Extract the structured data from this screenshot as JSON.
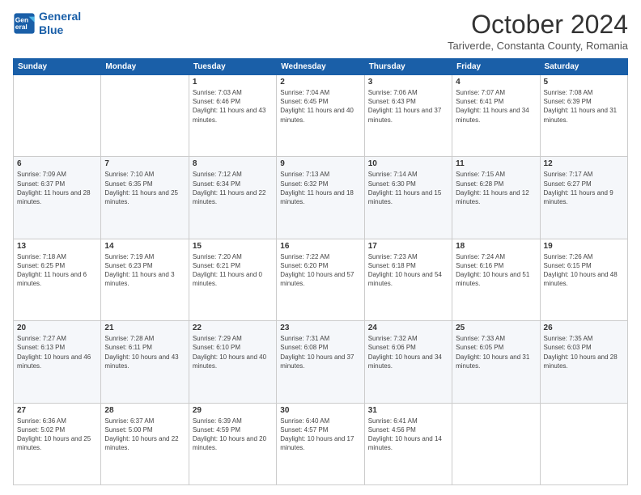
{
  "logo": {
    "line1": "General",
    "line2": "Blue"
  },
  "title": "October 2024",
  "location": "Tariverde, Constanta County, Romania",
  "days_header": [
    "Sunday",
    "Monday",
    "Tuesday",
    "Wednesday",
    "Thursday",
    "Friday",
    "Saturday"
  ],
  "weeks": [
    [
      {
        "day": "",
        "info": ""
      },
      {
        "day": "",
        "info": ""
      },
      {
        "day": "1",
        "info": "Sunrise: 7:03 AM\nSunset: 6:46 PM\nDaylight: 11 hours and 43 minutes."
      },
      {
        "day": "2",
        "info": "Sunrise: 7:04 AM\nSunset: 6:45 PM\nDaylight: 11 hours and 40 minutes."
      },
      {
        "day": "3",
        "info": "Sunrise: 7:06 AM\nSunset: 6:43 PM\nDaylight: 11 hours and 37 minutes."
      },
      {
        "day": "4",
        "info": "Sunrise: 7:07 AM\nSunset: 6:41 PM\nDaylight: 11 hours and 34 minutes."
      },
      {
        "day": "5",
        "info": "Sunrise: 7:08 AM\nSunset: 6:39 PM\nDaylight: 11 hours and 31 minutes."
      }
    ],
    [
      {
        "day": "6",
        "info": "Sunrise: 7:09 AM\nSunset: 6:37 PM\nDaylight: 11 hours and 28 minutes."
      },
      {
        "day": "7",
        "info": "Sunrise: 7:10 AM\nSunset: 6:35 PM\nDaylight: 11 hours and 25 minutes."
      },
      {
        "day": "8",
        "info": "Sunrise: 7:12 AM\nSunset: 6:34 PM\nDaylight: 11 hours and 22 minutes."
      },
      {
        "day": "9",
        "info": "Sunrise: 7:13 AM\nSunset: 6:32 PM\nDaylight: 11 hours and 18 minutes."
      },
      {
        "day": "10",
        "info": "Sunrise: 7:14 AM\nSunset: 6:30 PM\nDaylight: 11 hours and 15 minutes."
      },
      {
        "day": "11",
        "info": "Sunrise: 7:15 AM\nSunset: 6:28 PM\nDaylight: 11 hours and 12 minutes."
      },
      {
        "day": "12",
        "info": "Sunrise: 7:17 AM\nSunset: 6:27 PM\nDaylight: 11 hours and 9 minutes."
      }
    ],
    [
      {
        "day": "13",
        "info": "Sunrise: 7:18 AM\nSunset: 6:25 PM\nDaylight: 11 hours and 6 minutes."
      },
      {
        "day": "14",
        "info": "Sunrise: 7:19 AM\nSunset: 6:23 PM\nDaylight: 11 hours and 3 minutes."
      },
      {
        "day": "15",
        "info": "Sunrise: 7:20 AM\nSunset: 6:21 PM\nDaylight: 11 hours and 0 minutes."
      },
      {
        "day": "16",
        "info": "Sunrise: 7:22 AM\nSunset: 6:20 PM\nDaylight: 10 hours and 57 minutes."
      },
      {
        "day": "17",
        "info": "Sunrise: 7:23 AM\nSunset: 6:18 PM\nDaylight: 10 hours and 54 minutes."
      },
      {
        "day": "18",
        "info": "Sunrise: 7:24 AM\nSunset: 6:16 PM\nDaylight: 10 hours and 51 minutes."
      },
      {
        "day": "19",
        "info": "Sunrise: 7:26 AM\nSunset: 6:15 PM\nDaylight: 10 hours and 48 minutes."
      }
    ],
    [
      {
        "day": "20",
        "info": "Sunrise: 7:27 AM\nSunset: 6:13 PM\nDaylight: 10 hours and 46 minutes."
      },
      {
        "day": "21",
        "info": "Sunrise: 7:28 AM\nSunset: 6:11 PM\nDaylight: 10 hours and 43 minutes."
      },
      {
        "day": "22",
        "info": "Sunrise: 7:29 AM\nSunset: 6:10 PM\nDaylight: 10 hours and 40 minutes."
      },
      {
        "day": "23",
        "info": "Sunrise: 7:31 AM\nSunset: 6:08 PM\nDaylight: 10 hours and 37 minutes."
      },
      {
        "day": "24",
        "info": "Sunrise: 7:32 AM\nSunset: 6:06 PM\nDaylight: 10 hours and 34 minutes."
      },
      {
        "day": "25",
        "info": "Sunrise: 7:33 AM\nSunset: 6:05 PM\nDaylight: 10 hours and 31 minutes."
      },
      {
        "day": "26",
        "info": "Sunrise: 7:35 AM\nSunset: 6:03 PM\nDaylight: 10 hours and 28 minutes."
      }
    ],
    [
      {
        "day": "27",
        "info": "Sunrise: 6:36 AM\nSunset: 5:02 PM\nDaylight: 10 hours and 25 minutes."
      },
      {
        "day": "28",
        "info": "Sunrise: 6:37 AM\nSunset: 5:00 PM\nDaylight: 10 hours and 22 minutes."
      },
      {
        "day": "29",
        "info": "Sunrise: 6:39 AM\nSunset: 4:59 PM\nDaylight: 10 hours and 20 minutes."
      },
      {
        "day": "30",
        "info": "Sunrise: 6:40 AM\nSunset: 4:57 PM\nDaylight: 10 hours and 17 minutes."
      },
      {
        "day": "31",
        "info": "Sunrise: 6:41 AM\nSunset: 4:56 PM\nDaylight: 10 hours and 14 minutes."
      },
      {
        "day": "",
        "info": ""
      },
      {
        "day": "",
        "info": ""
      }
    ]
  ]
}
